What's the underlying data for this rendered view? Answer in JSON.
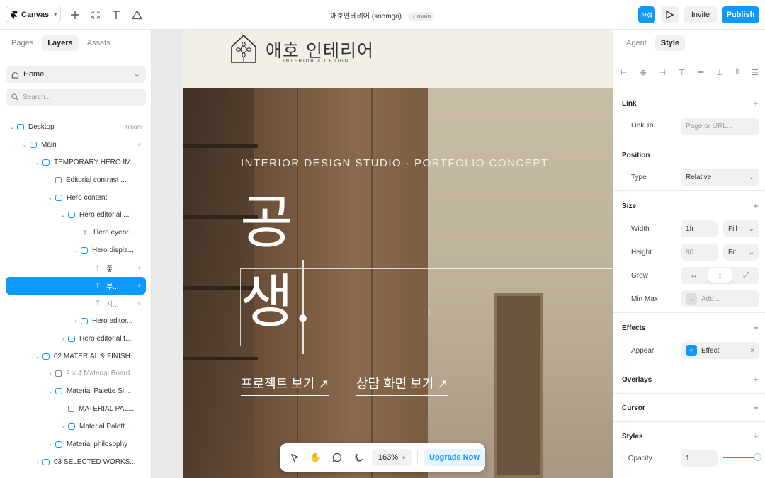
{
  "topbar": {
    "app_menu_label": "Canvas",
    "doc_title": "애호인테리어 (soomgo)",
    "branch": "main",
    "lang_label": "한형",
    "invite_label": "Invite",
    "publish_label": "Publish"
  },
  "left_panel": {
    "tabs": [
      "Pages",
      "Layers",
      "Assets"
    ],
    "active_tab": "Layers",
    "page_select": "Home",
    "search_placeholder": "Search...",
    "layers": [
      {
        "label": "Desktop",
        "right": "Primary"
      },
      {
        "label": "Main"
      },
      {
        "label": "TEMPORARY HERO IM..."
      },
      {
        "label": "Editorial contrast ..."
      },
      {
        "label": "Hero content"
      },
      {
        "label": "Hero editorial ..."
      },
      {
        "label": "Hero eyebr..."
      },
      {
        "label": "Hero displa..."
      },
      {
        "label": "좋..."
      },
      {
        "label": "부..."
      },
      {
        "label": "시..."
      },
      {
        "label": "Hero editor..."
      },
      {
        "label": "Hero editorial f..."
      },
      {
        "label": "02 MATERIAL & FINISH"
      },
      {
        "label": "2 × 4 Material Board"
      },
      {
        "label": "Material Palette Si..."
      },
      {
        "label": "MATERIAL PAL..."
      },
      {
        "label": "Material Palett..."
      },
      {
        "label": "Material philosophy"
      },
      {
        "label": "03 SELECTED WORKS..."
      }
    ]
  },
  "canvas": {
    "logo_text": "애호 인테리어",
    "logo_sub": "INTERIOR & DESIGN",
    "eyebrow": "INTERIOR DESIGN STUDIO · PORTFOLIO CONCEPT",
    "display_line1": "공",
    "display_line2": "생.",
    "link1": "프로젝트 보기 ↗",
    "link2": "상담 화면 보기 ↗",
    "zoom": "163%",
    "upgrade_label": "Upgrade Now"
  },
  "right_panel": {
    "tabs": [
      "Agent",
      "Style"
    ],
    "active_tab": "Style",
    "link": {
      "title": "Link",
      "link_to_label": "Link To",
      "link_to_placeholder": "Page or URL..."
    },
    "position": {
      "title": "Position",
      "type_label": "Type",
      "type_value": "Relative"
    },
    "size": {
      "title": "Size",
      "width_label": "Width",
      "width_value": "1fr",
      "width_mode": "Fill",
      "height_label": "Height",
      "height_value": "80",
      "height_mode": "Fit",
      "grow_label": "Grow",
      "minmax_label": "Min Max",
      "minmax_placeholder": "Add..."
    },
    "effects": {
      "title": "Effects",
      "appear_label": "Appear",
      "effect_value": "Effect"
    },
    "overlays": {
      "title": "Overlays"
    },
    "cursor": {
      "title": "Cursor"
    },
    "styles": {
      "title": "Styles",
      "opacity_label": "Opacity",
      "opacity_value": "1"
    }
  },
  "colors": {
    "accent": "#0d99ff"
  }
}
